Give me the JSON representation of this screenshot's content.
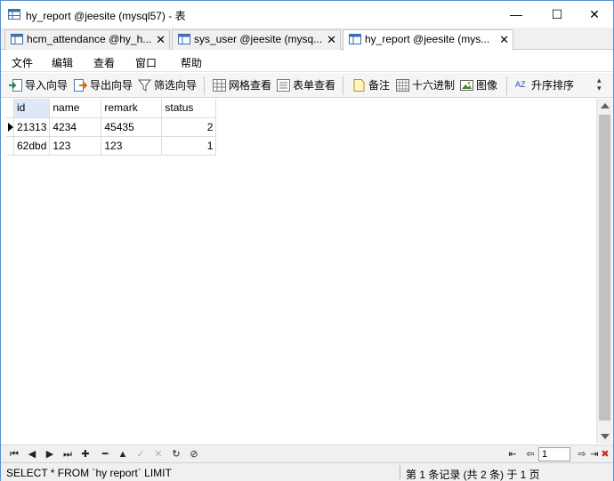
{
  "window": {
    "title": "hy_report @jeesite (mysql57) - 表",
    "controls": {
      "minimize": "—",
      "maximize": "☐",
      "close": "✕"
    }
  },
  "tabs": [
    {
      "label": "hcm_attendance @hy_h...",
      "close": "✕",
      "active": false
    },
    {
      "label": "sys_user @jeesite (mysq...",
      "close": "✕",
      "active": false
    },
    {
      "label": "hy_report @jeesite (mys...",
      "close": "✕",
      "active": true
    }
  ],
  "menu": [
    "文件",
    "编辑",
    "查看",
    "窗口",
    "帮助"
  ],
  "toolbar": {
    "import_wizard": "导入向导",
    "export_wizard": "导出向导",
    "filter_wizard": "筛选向导",
    "grid_view": "网格查看",
    "form_view": "表单查看",
    "memo": "备注",
    "hex": "十六进制",
    "image": "图像",
    "sort_asc": "升序排序",
    "sort_asc_icon_text": "AZ"
  },
  "grid": {
    "columns": [
      "id",
      "name",
      "remark",
      "status"
    ],
    "rows": [
      {
        "id": "21313",
        "name": "4234",
        "remark": "45435",
        "status": "2"
      },
      {
        "id": "62dbd",
        "name": "123",
        "remark": "123",
        "status": "1"
      }
    ]
  },
  "nav": {
    "first": "⏮",
    "prev": "◀",
    "next": "▶",
    "last": "⏭",
    "add": "✚",
    "delete": "━",
    "up": "▲",
    "apply": "✓",
    "cancel": "✕",
    "refresh": "↻",
    "stop": "⊘",
    "page_first": "⇤",
    "page_prev": "⇦",
    "page_value": "1",
    "page_next": "⇨",
    "page_last": "⇥",
    "tools": "✖"
  },
  "status": {
    "sql": "SELECT * FROM `hy report` LIMIT",
    "records": "第 1 条记录 (共 2 条) 于 1 页"
  },
  "colors": {
    "window_border": "#5a8fd0",
    "selected_column": "#dde9f6",
    "toolbar_bg": "#f5f5f5"
  }
}
